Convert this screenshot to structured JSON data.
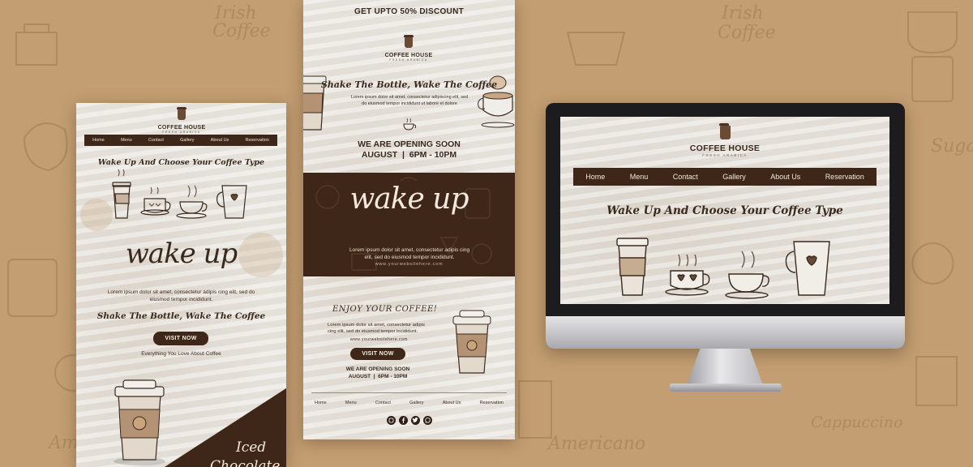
{
  "background_words": [
    "Irish",
    "Coffee",
    "Americano",
    "Cappuccino",
    "Sugar",
    "Am"
  ],
  "colors": {
    "background": "#c39e72",
    "card": "#e9e5df",
    "brown_dark": "#3e2718",
    "text_dark": "#3b2a1d"
  },
  "brand": {
    "name_left": "COFFEE",
    "name_right": "HOUSE",
    "tagline": "FRESH ARABICA"
  },
  "nav": [
    "Home",
    "Menu",
    "Contact",
    "Gallery",
    "About Us",
    "Reservation"
  ],
  "left_email": {
    "headline": "Wake Up And Choose Your Coffee Type",
    "hero_script": "wake up",
    "body": "Lorem ipsum dolor sit amet, consectetur adipis cing elit, sed do eiusmod tempor incididunt.",
    "tagline": "Shake The Bottle, Wake The Coffee",
    "button": "VISIT NOW",
    "subtext": "Everything You Love About Coffee",
    "corner_script_1": "Iced",
    "corner_script_2": "Chocolate"
  },
  "center_email": {
    "top_banner": "GET UPTO 50% DISCOUNT",
    "headline": "Shake The Bottle, Wake The Coffee",
    "intro": "Lorem ipsum dolor sit amet, consectetur adipiscing elit, sed do eiusmod tempor incididunt ut labore et dolore",
    "opening_title": "WE ARE OPENING SOON",
    "opening_date": "AUGUST  |  6PM - 10PM",
    "hero_script": "wake up",
    "hero_body": "Lorem ipsum dolor sit amet, consectetur adipis cing elit, sed do eiusmod tempor incididunt.",
    "hero_url": "www.yourwebsitehere.com",
    "enjoy_title": "ENJOY YOUR COFFEE!",
    "enjoy_body": "Lorem ipsum dolor sit amet, consectetur adipis cing elit, sed do eiusmod tempor incididunt.",
    "enjoy_url": "www.yourwebsitehere.com",
    "button": "VISIT NOW",
    "small_opening_title": "WE ARE OPENING SOON",
    "small_opening_date": "AUGUST  |  6PM - 10PM",
    "social_icons": [
      "instagram-icon",
      "facebook-icon",
      "twitter-icon",
      "whatsapp-icon"
    ]
  },
  "desktop": {
    "headline": "Wake Up And Choose Your Coffee Type"
  }
}
